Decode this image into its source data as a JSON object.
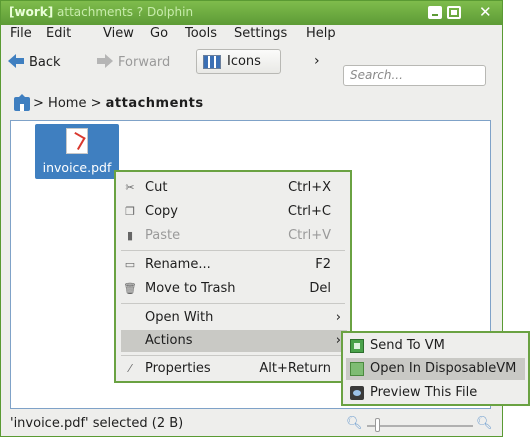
{
  "window": {
    "title_tag": "[work]",
    "title_rest": " attachments ? Dolphin"
  },
  "menubar": [
    "File",
    "Edit",
    "View",
    "Go",
    "Tools",
    "Settings",
    "Help"
  ],
  "toolbar": {
    "back": "Back",
    "forward": "Forward",
    "view_mode": "Icons",
    "more": "›",
    "search_placeholder": "Search..."
  },
  "breadcrumb": {
    "home": "Home",
    "sep": ">",
    "current": "attachments"
  },
  "files": [
    {
      "name": "invoice.pdf",
      "icon": "pdf-icon"
    }
  ],
  "context_menu": {
    "items": [
      {
        "label": "Cut",
        "shortcut": "Ctrl+X",
        "icon": "scissors-icon",
        "enabled": true
      },
      {
        "label": "Copy",
        "shortcut": "Ctrl+C",
        "icon": "copy-icon",
        "enabled": true
      },
      {
        "label": "Paste",
        "shortcut": "Ctrl+V",
        "icon": "paste-icon",
        "enabled": false
      },
      {
        "label": "Rename...",
        "shortcut": "F2",
        "icon": "rename-icon",
        "enabled": true
      },
      {
        "label": "Move to Trash",
        "shortcut": "Del",
        "icon": "trash-icon",
        "enabled": true
      },
      {
        "label": "Open With",
        "submenu": true
      },
      {
        "label": "Actions",
        "submenu": true,
        "highlighted": true
      },
      {
        "label": "Properties",
        "shortcut": "Alt+Return",
        "icon": "properties-icon",
        "enabled": true
      }
    ]
  },
  "actions_submenu": [
    {
      "label": "Send To VM",
      "icon": "send-vm-icon"
    },
    {
      "label": "Open In DisposableVM",
      "icon": "disposable-vm-icon",
      "highlighted": true
    },
    {
      "label": "Preview This File",
      "icon": "preview-icon"
    }
  ],
  "status": {
    "text": "'invoice.pdf' selected (2 B)",
    "zoom_level": 0.1
  },
  "colors": {
    "titlebar": "#6aa840",
    "selection": "#3f7fc0",
    "menu_border": "#6aa242"
  }
}
